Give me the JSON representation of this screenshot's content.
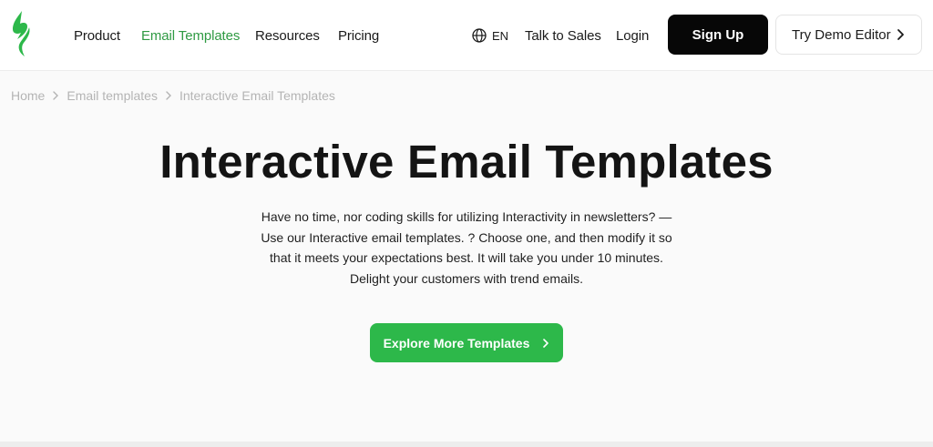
{
  "header": {
    "logo_icon": "stripo-leaf-logo-icon",
    "nav": [
      {
        "label": "Product",
        "active": false
      },
      {
        "label": "Email Templates",
        "active": true
      },
      {
        "label": "Resources",
        "active": false
      },
      {
        "label": "Pricing",
        "active": false
      }
    ],
    "language": {
      "icon": "globe-icon",
      "label": "EN"
    },
    "talk_to_sales": "Talk to Sales",
    "login": "Login",
    "signup": "Sign Up",
    "demo": {
      "label": "Try Demo Editor",
      "icon": "chevron-right-icon"
    }
  },
  "breadcrumb": {
    "items": [
      "Home",
      "Email templates",
      "Interactive Email Templates"
    ],
    "separator_icon": "chevron-right-icon"
  },
  "hero": {
    "title": "Interactive Email Templates",
    "description": [
      "Have no time, nor coding skills for utilizing Interactivity in newsletters? —",
      "Use our Interactive email templates. ? Choose one, and then modify it so",
      "that it meets your expectations best. It will take you under 10 minutes.",
      "Delight your customers with trend emails."
    ],
    "cta": {
      "label": "Explore More Templates",
      "icon": "chevron-right-icon"
    }
  },
  "colors": {
    "accent_green": "#2db84a",
    "active_nav_green": "#2f9a43",
    "signup_bg": "#070707",
    "breadcrumb_gray": "#b4b4b4"
  }
}
